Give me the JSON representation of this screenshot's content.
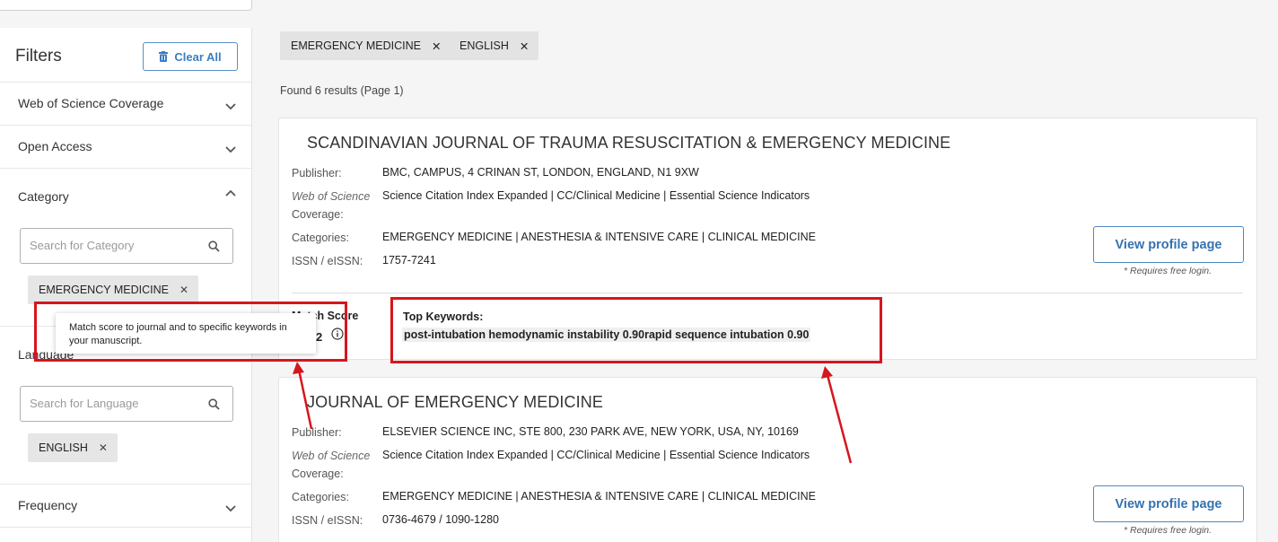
{
  "sidebar": {
    "title": "Filters",
    "clear_all": "Clear All",
    "sections": {
      "wos_coverage": "Web of Science Coverage",
      "open_access": "Open Access",
      "category": "Category",
      "language": "Language",
      "frequency": "Frequency"
    },
    "category_search_placeholder": "Search for Category",
    "language_search_placeholder": "Search for Language",
    "category_chip": "EMERGENCY MEDICINE",
    "language_chip": "ENGLISH"
  },
  "tooltip": "Match score to journal and to specific keywords in your manuscript.",
  "active_filters": [
    "EMERGENCY MEDICINE",
    "ENGLISH"
  ],
  "results_count": "Found 6 results (Page 1)",
  "labels": {
    "publisher": "Publisher:",
    "wos_line1": "Web of Science",
    "wos_line2": "Coverage:",
    "categories": "Categories:",
    "issn": "ISSN / eISSN:",
    "view_profile": "View profile page",
    "requires_login": "* Requires free login.",
    "match_score": "Match Score",
    "top_keywords": "Top Keywords:"
  },
  "results": [
    {
      "title": "SCANDINAVIAN JOURNAL OF TRAUMA RESUSCITATION & EMERGENCY MEDICINE",
      "publisher": "BMC, CAMPUS, 4 CRINAN ST, LONDON, ENGLAND, N1 9XW",
      "coverage": "Science Citation Index Expanded | CC/Clinical Medicine | Essential Science Indicators",
      "categories": "EMERGENCY MEDICINE | ANESTHESIA & INTENSIVE CARE | CLINICAL MEDICINE",
      "issn": "1757-7241",
      "match_score_partial": "2",
      "keywords": "post-intubation hemodynamic instability 0.90rapid sequence intubation 0.90"
    },
    {
      "title": "JOURNAL OF EMERGENCY MEDICINE",
      "publisher": "ELSEVIER SCIENCE INC, STE 800, 230 PARK AVE, NEW YORK, USA, NY, 10169",
      "coverage": "Science Citation Index Expanded | CC/Clinical Medicine | Essential Science Indicators",
      "categories": "EMERGENCY MEDICINE | ANESTHESIA & INTENSIVE CARE | CLINICAL MEDICINE",
      "issn": "0736-4679 / 1090-1280"
    }
  ],
  "colors": {
    "accent_blue": "#3472b0",
    "annotation_red": "#d6161e",
    "chip_gray": "#e3e3e3"
  }
}
